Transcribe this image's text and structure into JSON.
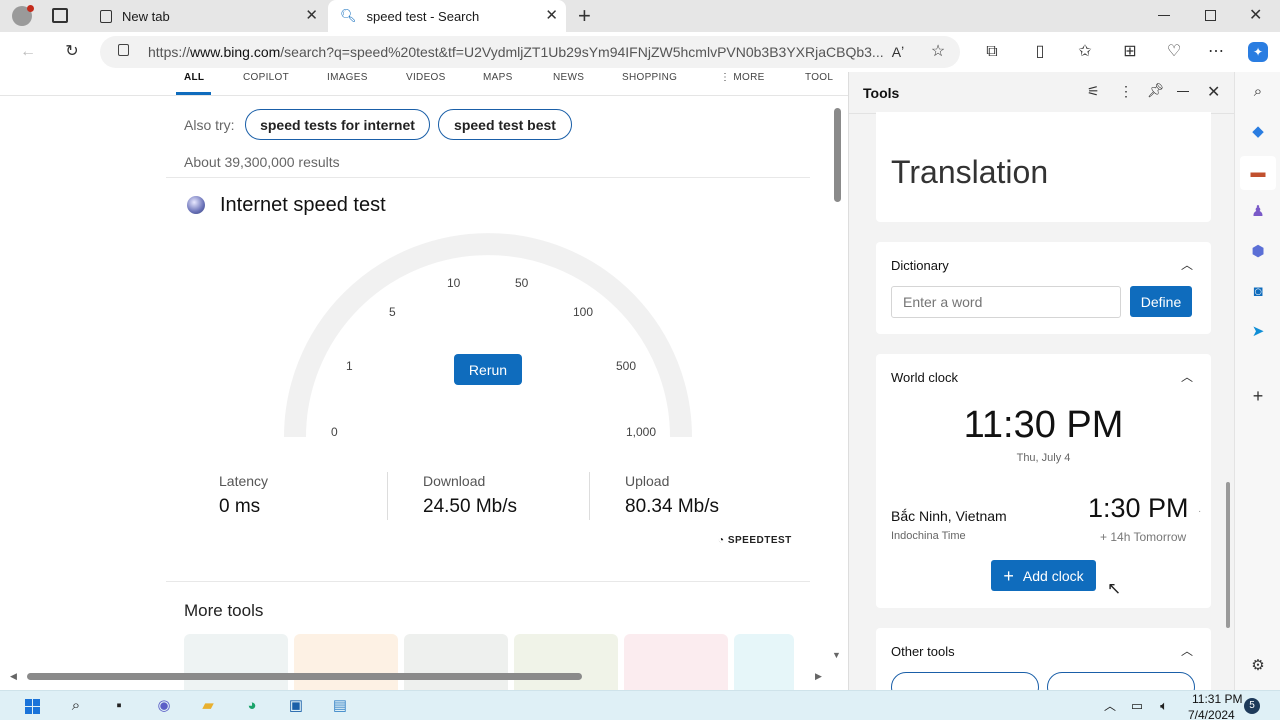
{
  "browser": {
    "tabs": [
      {
        "label": "New tab",
        "icon": "page-icon"
      },
      {
        "label": "speed test - Search",
        "icon": "search-icon"
      }
    ],
    "url_prefix": "https://",
    "url_domain": "www.bing.com",
    "url_rest": "/search?q=speed%20test&tf=U2VydmljZT1Ub29sYm94IFNjZW5hcmlvPVN0b3B3YXRjaCBQb3..."
  },
  "search": {
    "nav_tabs": [
      "ALL",
      "COPILOT",
      "IMAGES",
      "VIDEOS",
      "MAPS",
      "NEWS",
      "SHOPPING",
      "⋮ MORE",
      "TOOL"
    ],
    "also_try_label": "Also try:",
    "also_try": [
      "speed tests for internet",
      "speed test best"
    ],
    "result_count": "About 39,300,000 results",
    "widget_title": "Internet speed test",
    "gauge_labels": [
      "0",
      "1",
      "5",
      "10",
      "50",
      "100",
      "500",
      "1,000"
    ],
    "rerun_label": "Rerun",
    "metrics": [
      {
        "label": "Latency",
        "value": "0 ms"
      },
      {
        "label": "Download",
        "value": "24.50 Mb/s"
      },
      {
        "label": "Upload",
        "value": "80.34 Mb/s"
      }
    ],
    "speedtest_brand": "SPEEDTEST",
    "more_tools_title": "More tools"
  },
  "tools": {
    "title": "Tools",
    "translation_title": "Translation",
    "dictionary": {
      "title": "Dictionary",
      "placeholder": "Enter a word",
      "button": "Define"
    },
    "world_clock": {
      "title": "World clock",
      "local_time": "11:30 PM",
      "local_date": "Thu, July 4",
      "city": "Bắc Ninh, Vietnam",
      "timezone": "Indochina Time",
      "city_time": "1:30 PM",
      "offset": "+ 14h Tomorrow",
      "add_button": "Add clock"
    },
    "other_tools_title": "Other tools"
  },
  "taskbar": {
    "time": "11:31 PM",
    "date": "7/4/2024",
    "notification_count": "5"
  },
  "colors": {
    "accent": "#0f6cbd",
    "chip_border": "#1a5fa8"
  }
}
